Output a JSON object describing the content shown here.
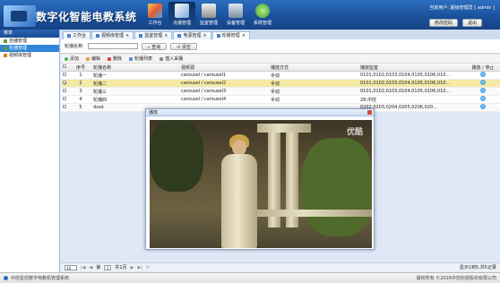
{
  "header": {
    "app_title": "数字化智能电教系统",
    "nav": [
      {
        "label": "工作台",
        "icon": "workbench-icon",
        "color": "#e9b233"
      },
      {
        "label": "点播管理",
        "icon": "vod-icon",
        "color": "#9ab6d8",
        "active": true
      },
      {
        "label": "监室管理",
        "icon": "cell-icon",
        "color": "#d5d5d5"
      },
      {
        "label": "设备管理",
        "icon": "device-icon",
        "color": "#c0c8d4"
      },
      {
        "label": "系统管理",
        "icon": "settings-icon",
        "color": "#6cc24a"
      }
    ],
    "user_info": "当前用户: 超级管理员 [ admin ]",
    "change_password": "修改密码",
    "logout": "退出"
  },
  "sidebar": {
    "title": "菜单",
    "items": [
      {
        "label": "自播管理"
      },
      {
        "label": "轮播管理",
        "active": true
      },
      {
        "label": "视频库管理"
      }
    ]
  },
  "tabs": [
    {
      "label": "工作台"
    },
    {
      "label": "视频库管理"
    },
    {
      "label": "监室管理"
    },
    {
      "label": "电源管理"
    },
    {
      "label": "轮播管理",
      "active": true
    }
  ],
  "search": {
    "label": "轮播名称:",
    "value": "",
    "search_button": "查询",
    "clear_button": "清空"
  },
  "toolbar": {
    "add": "添加",
    "edit": "编辑",
    "delete": "删除",
    "list": "轮播列表",
    "insert": "插入采播"
  },
  "table": {
    "columns": [
      "序号",
      "轮播名称",
      "视频源",
      "播放方式",
      "播放监室",
      "播放 / 停止"
    ],
    "rows": [
      {
        "no": "1",
        "name": "轮播一",
        "video": "carousel / carousel1",
        "mode": "手动",
        "classes": "0101,0102,0103,0104,0105,0106,010..."
      },
      {
        "no": "2",
        "name": "轮播二",
        "video": "carousel / carousel2",
        "mode": "手动",
        "classes": "0101,0102,0103,0104,0105,0106,010...",
        "selected": true
      },
      {
        "no": "3",
        "name": "轮播三",
        "video": "carousel / carousel3",
        "mode": "手动",
        "classes": "0101,0102,0103,0104,0105,0106,010..."
      },
      {
        "no": "4",
        "name": "轮播四",
        "video": "carousel / carousel4",
        "mode": "手动",
        "classes": "28,中控"
      },
      {
        "no": "5",
        "name": "dssd",
        "video": "",
        "mode": "",
        "classes": "0202,0203,0204,0205,0206,020..."
      }
    ]
  },
  "dialog": {
    "title": "播放",
    "watermark": "优酷"
  },
  "pager": {
    "page_size": "10",
    "page_label": "第",
    "page": "1",
    "of_label": "共1页",
    "info": "显示1到5,共5记录"
  },
  "footer": {
    "left": "中控星控数字电教机管理系统",
    "right": "版权所有 ©2016中控科技股份有限公司"
  }
}
